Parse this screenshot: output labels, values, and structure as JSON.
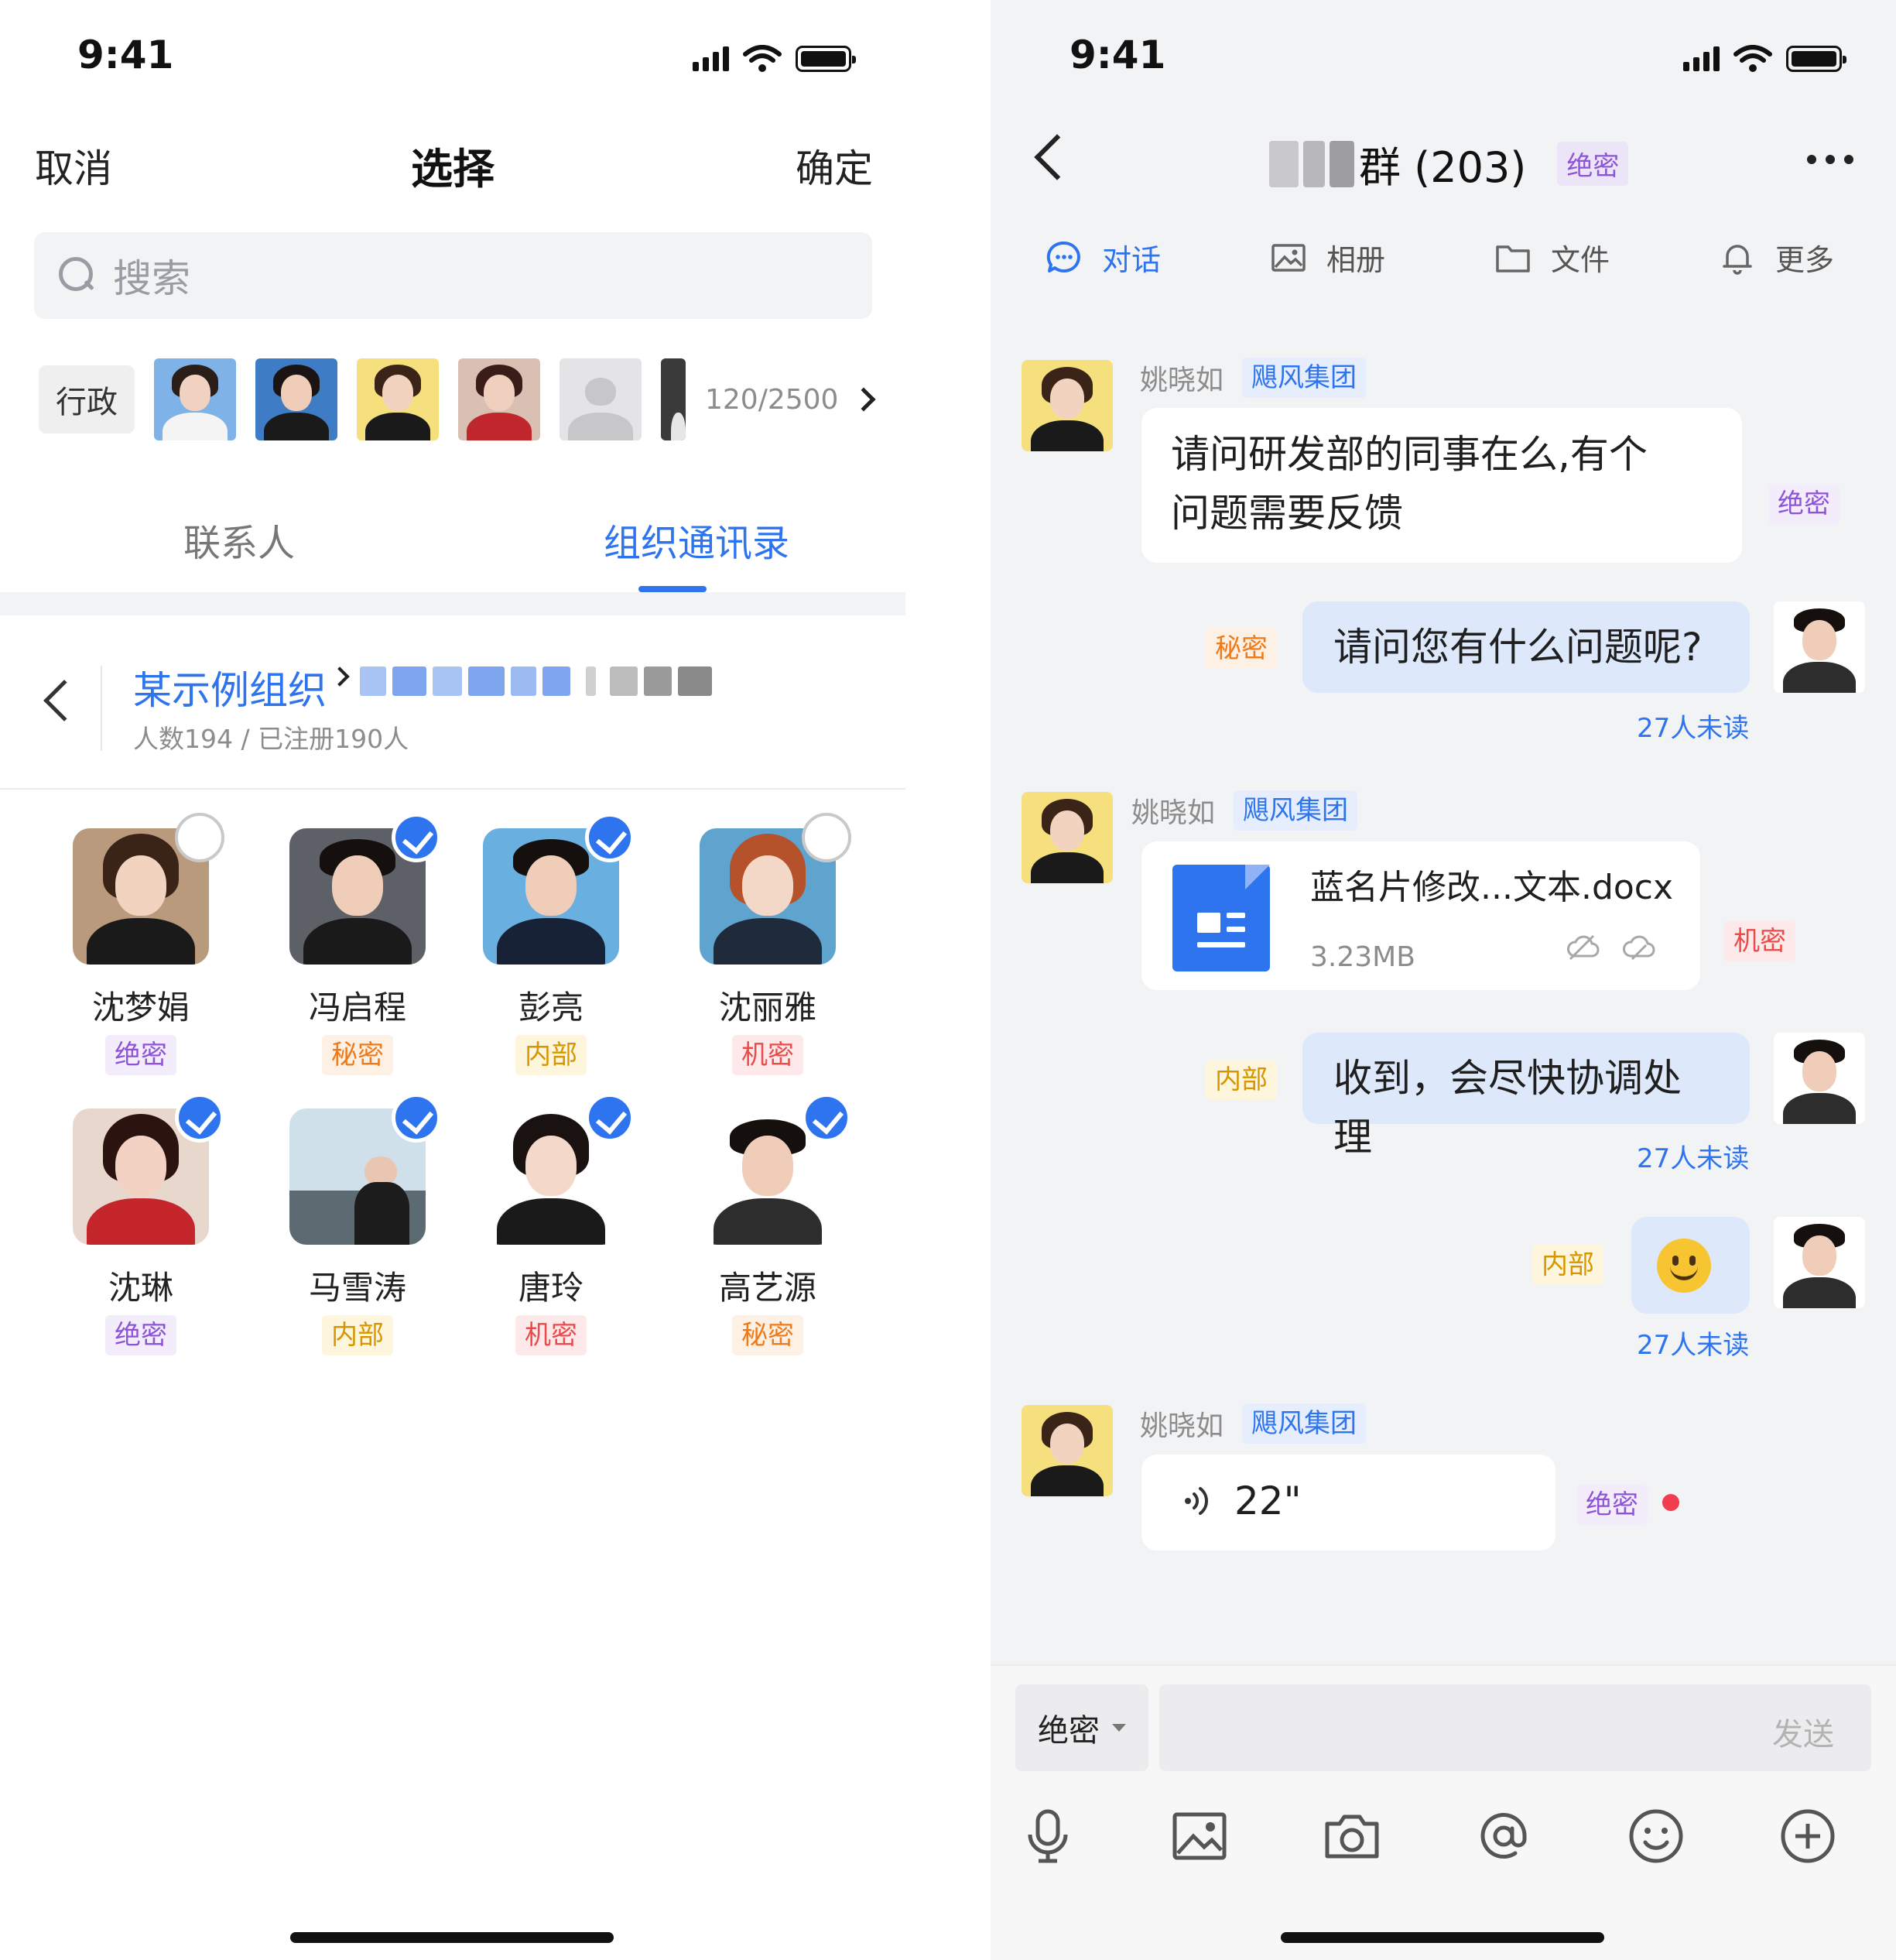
{
  "status": {
    "time": "9:41"
  },
  "left": {
    "nav": {
      "cancel": "取消",
      "title": "选择",
      "confirm": "确定"
    },
    "search": {
      "placeholder": "搜索"
    },
    "selected": {
      "chip": "行政",
      "count": "120/2500"
    },
    "tabs": [
      {
        "label": "联系人"
      },
      {
        "label": "组织通讯录"
      }
    ],
    "breadcrumb": {
      "org": "某示例组织",
      "subtitle": "人数194 / 已注册190人"
    },
    "people": [
      {
        "name": "沈梦娟",
        "tag": "绝密",
        "checked": false
      },
      {
        "name": "冯启程",
        "tag": "秘密",
        "checked": true
      },
      {
        "name": "彭亮",
        "tag": "内部",
        "checked": true
      },
      {
        "name": "沈丽雅",
        "tag": "机密",
        "checked": false
      },
      {
        "name": "沈琳",
        "tag": "绝密",
        "checked": true
      },
      {
        "name": "马雪涛",
        "tag": "内部",
        "checked": true
      },
      {
        "name": "唐玲",
        "tag": "机密",
        "checked": true
      },
      {
        "name": "高艺源",
        "tag": "秘密",
        "checked": true
      }
    ]
  },
  "right": {
    "header": {
      "title": "群 (203)",
      "title_tag": "绝密"
    },
    "tabs": [
      {
        "label": "对话"
      },
      {
        "label": "相册"
      },
      {
        "label": "文件"
      },
      {
        "label": "更多"
      }
    ],
    "messages": {
      "m1": {
        "sender": "姚晓如",
        "org": "飓风集团",
        "text_line1": "请问研发部的同事在么,有个",
        "text_line2": "问题需要反馈",
        "tag": "绝密"
      },
      "m2": {
        "text": "请问您有什么问题呢?",
        "tag": "秘密",
        "unread": "27人未读"
      },
      "m3": {
        "sender": "姚晓如",
        "org": "飓风集团",
        "file_name": "蓝名片修改...文本.docx",
        "file_size": "3.23MB",
        "tag": "机密"
      },
      "m4": {
        "text": "收到，会尽快协调处理",
        "tag": "内部",
        "unread": "27人未读"
      },
      "m5": {
        "emoji": "🙂",
        "tag": "内部",
        "unread": "27人未读"
      },
      "m6": {
        "sender": "姚晓如",
        "org": "飓风集团",
        "voice": "22\"",
        "tag": "绝密"
      }
    },
    "input": {
      "level": "绝密",
      "send": "发送"
    },
    "toolbar": [
      "microphone-icon",
      "image-icon",
      "camera-icon",
      "at-icon",
      "emoji-icon",
      "add-icon"
    ]
  }
}
